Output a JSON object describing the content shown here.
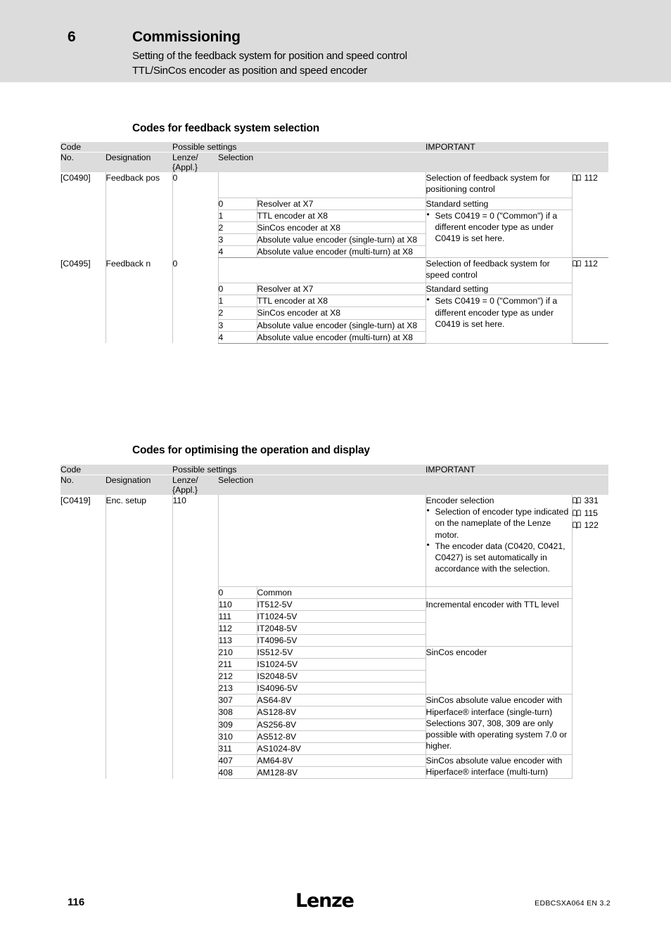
{
  "header": {
    "chapter_number": "6",
    "chapter_title": "Commissioning",
    "subtitle_1": "Setting of the feedback system for position and speed control",
    "subtitle_2": "TTL/SinCos encoder as position and speed encoder",
    "band_color": "#dcdcdc"
  },
  "sections": [
    {
      "heading": "Codes for feedback system selection"
    },
    {
      "heading": "Codes for optimising the operation and display"
    }
  ],
  "table_headers": {
    "code": "Code",
    "possible_settings": "Possible settings",
    "important": "IMPORTANT",
    "no": "No.",
    "designation": "Designation",
    "lenze_appl_line1": "Lenze/",
    "lenze_appl_line2": "{Appl.}",
    "selection": "Selection"
  },
  "icons": {
    "book": "book-icon"
  },
  "table_1": {
    "codes": [
      {
        "no": "[C0490]",
        "designation": "Feedback pos",
        "lenze_appl": "0",
        "intro_important": "Selection of feedback system for positioning control",
        "intro_refs": [
          "112"
        ],
        "selections": [
          {
            "value": "0",
            "label": "Resolver at X7"
          },
          {
            "value": "1",
            "label": "TTL encoder at X8"
          },
          {
            "value": "2",
            "label": "SinCos encoder at X8"
          },
          {
            "value": "3",
            "label": "Absolute value encoder (single-turn) at X8"
          },
          {
            "value": "4",
            "label": "Absolute value encoder (multi-turn) at X8"
          }
        ],
        "standard_setting": "Standard setting",
        "note_bullets": [
          "Sets C0419 = 0 (\"Common\") if a different encoder type as under C0419 is set here."
        ]
      },
      {
        "no": "[C0495]",
        "designation": "Feedback n",
        "lenze_appl": "0",
        "intro_important": "Selection of feedback system for speed control",
        "intro_refs": [
          "112"
        ],
        "selections": [
          {
            "value": "0",
            "label": "Resolver at X7"
          },
          {
            "value": "1",
            "label": "TTL encoder at X8"
          },
          {
            "value": "2",
            "label": "SinCos encoder at X8"
          },
          {
            "value": "3",
            "label": "Absolute value encoder (single-turn) at X8"
          },
          {
            "value": "4",
            "label": "Absolute value encoder (multi-turn) at X8"
          }
        ],
        "standard_setting": "Standard setting",
        "note_bullets": [
          "Sets C0419 = 0 (\"Common\") if a different encoder type as under C0419 is set here."
        ]
      }
    ]
  },
  "table_2": {
    "code": {
      "no": "[C0419]",
      "designation": "Enc. setup",
      "lenze_appl": "110",
      "intro_title": "Encoder selection",
      "intro_bullets": [
        "Selection of encoder type indicated on the nameplate of the Lenze motor.",
        "The encoder data (C0420, C0421, C0427) is set automatically in accordance with the selection."
      ],
      "intro_refs": [
        "331",
        "115",
        "122"
      ]
    },
    "groups": [
      {
        "rows": [
          {
            "value": "0",
            "label": "Common"
          }
        ],
        "important": ""
      },
      {
        "rows": [
          {
            "value": "110",
            "label": "IT512-5V"
          },
          {
            "value": "111",
            "label": "IT1024-5V"
          },
          {
            "value": "112",
            "label": "IT2048-5V"
          },
          {
            "value": "113",
            "label": "IT4096-5V"
          }
        ],
        "important": "Incremental encoder with TTL level"
      },
      {
        "rows": [
          {
            "value": "210",
            "label": "IS512-5V"
          },
          {
            "value": "211",
            "label": "IS1024-5V"
          },
          {
            "value": "212",
            "label": "IS2048-5V"
          },
          {
            "value": "213",
            "label": "IS4096-5V"
          }
        ],
        "important": "SinCos encoder"
      },
      {
        "rows": [
          {
            "value": "307",
            "label": "AS64-8V"
          },
          {
            "value": "308",
            "label": "AS128-8V"
          },
          {
            "value": "309",
            "label": "AS256-8V"
          },
          {
            "value": "310",
            "label": "AS512-8V"
          },
          {
            "value": "311",
            "label": "AS1024-8V"
          }
        ],
        "important": "SinCos absolute value encoder with Hiperface® interface (single-turn)",
        "important_2": "Selections 307, 308, 309 are only possible with operating system 7.0 or higher."
      },
      {
        "rows": [
          {
            "value": "407",
            "label": "AM64-8V"
          },
          {
            "value": "408",
            "label": "AM128-8V"
          }
        ],
        "important": "SinCos absolute value encoder with Hiperface® interface (multi-turn)"
      }
    ]
  },
  "footer": {
    "page_number": "116",
    "logo": "Lenze",
    "document_id": "EDBCSXA064 EN 3.2"
  }
}
